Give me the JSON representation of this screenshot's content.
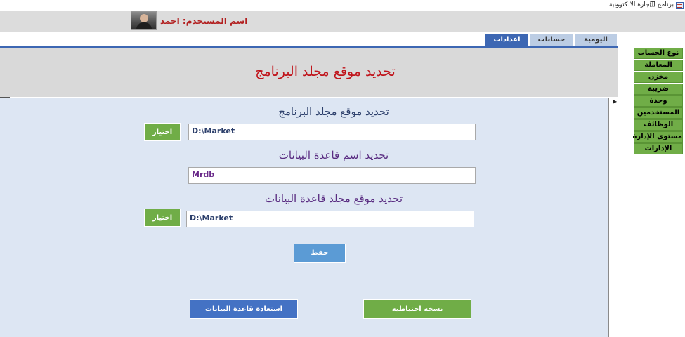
{
  "window": {
    "title": "برنامج التجارة الالكترونية",
    "minimize": "—",
    "restore": "❐"
  },
  "header": {
    "user_label": "اسم المستخدم: احمد"
  },
  "tabs": [
    {
      "label": "اعدادات",
      "active": true
    },
    {
      "label": "حسابات",
      "active": false
    },
    {
      "label": "اليومية",
      "active": false
    }
  ],
  "form": {
    "title": "تحديد موقع مجلد البرنامج",
    "sections": [
      {
        "title": "تحديد موقع مجلد البرنامج",
        "value": "D:\\Market",
        "button": "اختيار"
      },
      {
        "title": "تحديد اسم قاعدة البيانات",
        "value": "Mrdb"
      },
      {
        "title": "تحديد موقع مجلد قاعدة البيانات",
        "value": "D:\\Market",
        "button": "اختيار"
      }
    ],
    "save_label": "حفظ",
    "restore_label": "استعادة قاعدة البيانات",
    "backup_label": "نسخة احتياطية",
    "scroll_arrow": "▶"
  },
  "side_menu": [
    "نوع الحساب",
    "المعاملة",
    "مخزن",
    "ضريبة",
    "وحدة",
    "المستخدمين",
    "الوظائف",
    "مستوى الإدارة",
    "الإدارات"
  ],
  "colors": {
    "tab_active": "#3d67b3",
    "tab_inactive": "#bccde4",
    "title_red": "#c0141b",
    "menu_green": "#70ad47",
    "save_blue": "#5b9bd5",
    "restore_blue": "#4472c4",
    "panel_bg": "#dde6f3"
  }
}
